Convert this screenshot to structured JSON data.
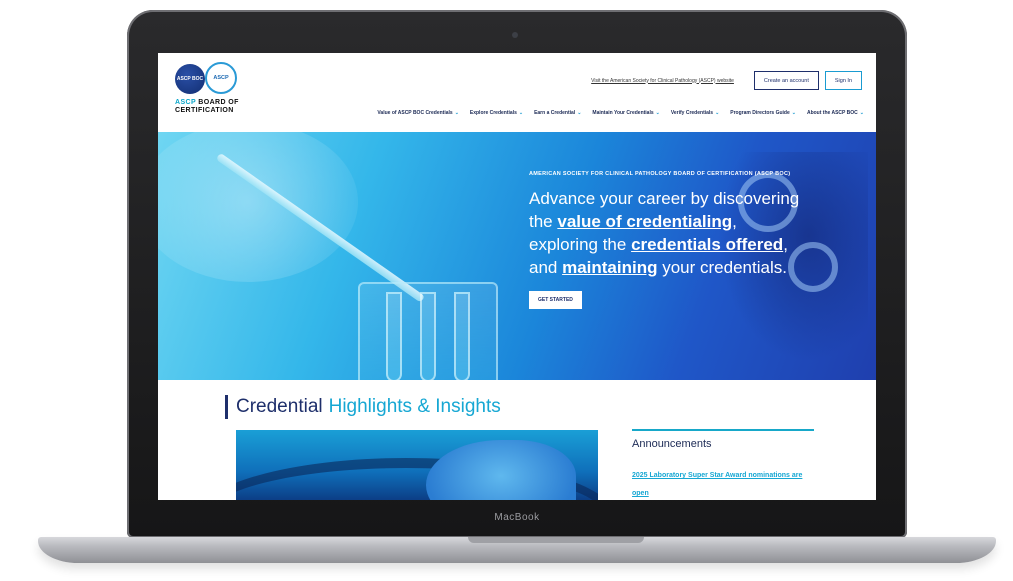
{
  "device": {
    "label": "MacBook"
  },
  "site": {
    "logo": {
      "badge_left": "ASCP BOC",
      "badge_right": "ASCP",
      "brand_prefix": "ASCP",
      "brand_rest": " BOARD OF",
      "brand_line2": "CERTIFICATION"
    },
    "top_bar": {
      "external_link": "Visit the American Society for Clinical Pathology (ASCP) website",
      "create_account": "Create an account",
      "sign_in": "Sign In"
    },
    "nav": [
      {
        "label": "Value of ASCP BOC Credentials"
      },
      {
        "label": "Explore Credentials"
      },
      {
        "label": "Earn a Credential"
      },
      {
        "label": "Maintain Your Credentials"
      },
      {
        "label": "Verify Credentials"
      },
      {
        "label": "Program Directors Guide"
      },
      {
        "label": "About the ASCP BOC"
      }
    ],
    "nav_chevron": "⌄",
    "hero": {
      "kicker": "AMERICAN SOCIETY FOR CLINICAL PATHOLOGY BOARD OF CERTIFICATION (ASCP BOC)",
      "h_part1": "Advance your career by discovering the ",
      "h_link1": "value of credentialing",
      "h_part2": ", exploring the ",
      "h_link2": "credentials offered",
      "h_part3": ", and ",
      "h_link3": "maintaining",
      "h_part4": " your credentials.",
      "cta": "GET STARTED"
    },
    "highlights": {
      "title_main": "Credential",
      "title_accent": "Highlights & Insights"
    },
    "announcements": {
      "title": "Announcements",
      "item1": "2025 Laboratory Super Star Award nominations are open"
    }
  },
  "colors": {
    "navy": "#1e2f6b",
    "accent": "#16a7d3"
  }
}
